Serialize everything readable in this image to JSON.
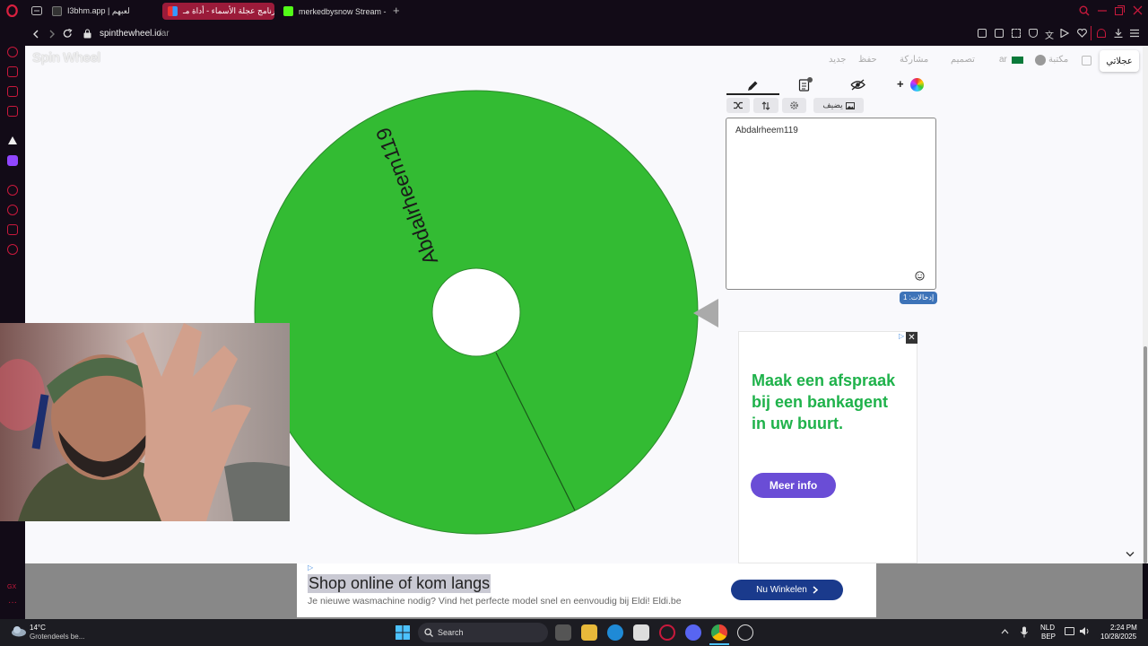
{
  "browser": {
    "tabs": [
      {
        "label": "I3bhm.app | لعبهم",
        "active": false,
        "color": "#333333"
      },
      {
        "label": "برنامج عجلة الأسماء - أداة مـ",
        "active": true,
        "color": "#d63384"
      },
      {
        "label": "merkedbysnow Stream - ",
        "active": false,
        "color": "#53fc18"
      }
    ],
    "new_tab": "+",
    "url_host": "spinthewheel.io",
    "url_path": "/ar"
  },
  "site": {
    "logo": "Spin Wheel",
    "header_items": [
      "جديد",
      "حفظ",
      "مشاركة",
      "تصميم",
      "ar",
      "مكتبة"
    ],
    "account": "عجلاتي"
  },
  "editor": {
    "tabs": [
      "edit-icon",
      "clipboard-icon",
      "eye-off-icon",
      "add-color-icon"
    ],
    "add_label": "+",
    "toolbar": {
      "shuffle": "shuffle-icon",
      "sort": "sort-icon",
      "settings": "gear-icon",
      "add_image": "يضيف"
    },
    "entries_text": "Abdalrheem119",
    "entries_count_label": "إدخالات: 1"
  },
  "wheel": {
    "entries": [
      "Abdalrheem119"
    ],
    "color": "#33bb33"
  },
  "side_ad": {
    "headline": "Maak een afspraak bij een bankagent in uw buurt.",
    "cta": "Meer info"
  },
  "bottom_ad": {
    "title": "Shop online of kom langs",
    "body": "Je nieuwe wasmachine nodig? Vind het perfecte model snel en eenvoudig bij Eldi! Eldi.be",
    "cta": "Nu Winkelen"
  },
  "taskbar": {
    "weather_temp": "14°C",
    "weather_desc": "Grotendeels be...",
    "search": "Search",
    "lang": "NLD",
    "lang2": "BEP",
    "time": "2:24 PM",
    "date": "10/28/2025"
  }
}
